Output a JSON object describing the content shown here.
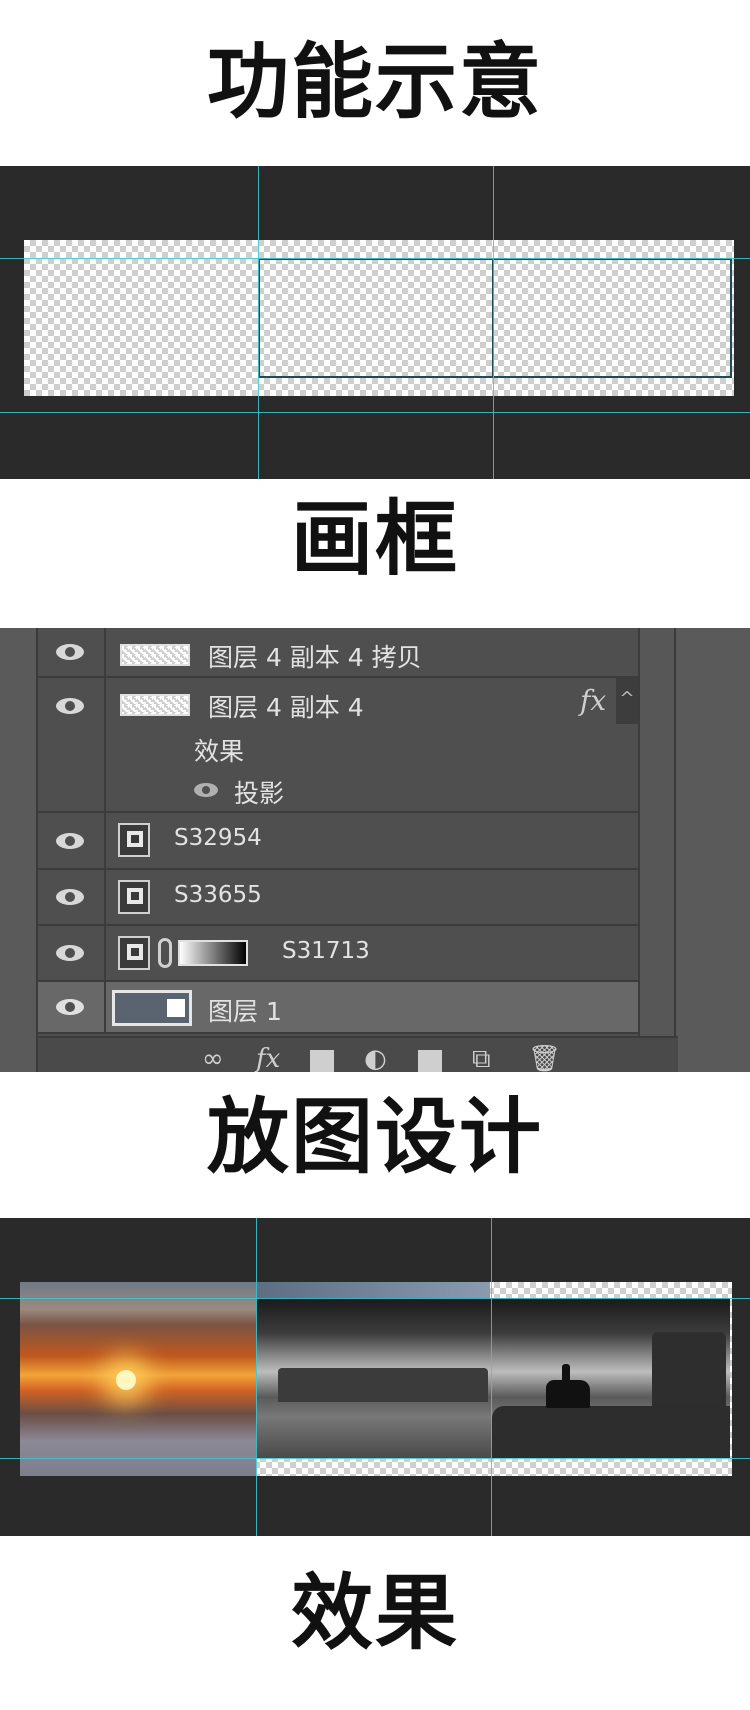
{
  "sections": {
    "title_1": "功能示意",
    "title_2": "画框",
    "title_3": "放图设计",
    "title_4": "效果"
  },
  "layers": [
    {
      "name": "图层 4 副本 4 拷贝",
      "type": "pixel"
    },
    {
      "name": "图层 4 副本 4",
      "type": "pixel",
      "fx": "fx",
      "effects_label": "效果",
      "effect": "投影"
    },
    {
      "name": "S32954",
      "type": "smart-object"
    },
    {
      "name": "S33655",
      "type": "smart-object"
    },
    {
      "name": "S31713",
      "type": "smart-object-with-mask"
    },
    {
      "name": "图层 1",
      "type": "pixel",
      "selected": true
    }
  ],
  "toolbar": {
    "icons": [
      "link-icon",
      "fx-icon",
      "mask-icon",
      "adjustment-icon",
      "folder-icon",
      "new-layer-icon",
      "trash-icon"
    ],
    "fx_label": "fx",
    "expand_arrow": "^"
  },
  "colors": {
    "guide": "#39c9d4",
    "workspace": "#2a2a2a",
    "panel": "#4f4f4f",
    "frame_border": "#1e4d5a"
  }
}
